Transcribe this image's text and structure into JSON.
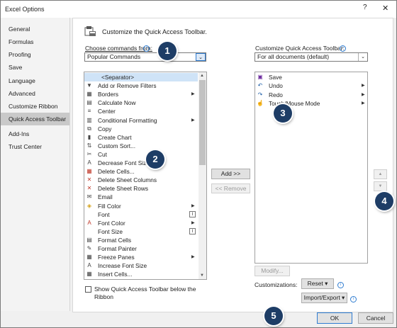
{
  "window": {
    "title": "Excel Options",
    "help_glyph": "?",
    "close_glyph": "✕"
  },
  "nav": {
    "items": [
      {
        "label": "General"
      },
      {
        "label": "Formulas"
      },
      {
        "label": "Proofing"
      },
      {
        "label": "Save"
      },
      {
        "label": "Language"
      },
      {
        "label": "Advanced"
      },
      {
        "label": "Customize Ribbon"
      },
      {
        "label": "Quick Access Toolbar",
        "active": true
      },
      {
        "label": "Add-Ins"
      },
      {
        "label": "Trust Center"
      }
    ]
  },
  "main": {
    "heading": "Customize the Quick Access Toolbar.",
    "choose_label": "Choose commands from:",
    "choose_value": "Popular Commands",
    "customize_label": "Customize Quick Access Toolbar:",
    "customize_value": "For all documents (default)",
    "commands": [
      {
        "label": "<Separator>",
        "icon": "separator-icon"
      },
      {
        "label": "Add or Remove Filters",
        "icon": "filter-icon"
      },
      {
        "label": "Borders",
        "icon": "borders-icon",
        "submenu": true
      },
      {
        "label": "Calculate Now",
        "icon": "calculator-icon"
      },
      {
        "label": "Center",
        "icon": "align-center-icon"
      },
      {
        "label": "Conditional Formatting",
        "icon": "conditional-formatting-icon",
        "submenu": true
      },
      {
        "label": "Copy",
        "icon": "copy-icon"
      },
      {
        "label": "Create Chart",
        "icon": "chart-icon"
      },
      {
        "label": "Custom Sort...",
        "icon": "sort-icon"
      },
      {
        "label": "Cut",
        "icon": "scissors-icon"
      },
      {
        "label": "Decrease Font Size",
        "icon": "decrease-font-icon"
      },
      {
        "label": "Delete Cells...",
        "icon": "delete-cells-icon"
      },
      {
        "label": "Delete Sheet Columns",
        "icon": "delete-columns-icon"
      },
      {
        "label": "Delete Sheet Rows",
        "icon": "delete-rows-icon"
      },
      {
        "label": "Email",
        "icon": "email-icon"
      },
      {
        "label": "Fill Color",
        "icon": "fill-color-icon",
        "submenu": true
      },
      {
        "label": "Font",
        "icon": "",
        "boxed": true
      },
      {
        "label": "Font Color",
        "icon": "font-color-icon",
        "submenu": true
      },
      {
        "label": "Font Size",
        "icon": "",
        "boxed": true
      },
      {
        "label": "Format Cells",
        "icon": "format-cells-icon"
      },
      {
        "label": "Format Painter",
        "icon": "format-painter-icon"
      },
      {
        "label": "Freeze Panes",
        "icon": "freeze-panes-icon",
        "submenu": true
      },
      {
        "label": "Increase Font Size",
        "icon": "increase-font-icon"
      },
      {
        "label": "Insert Cells...",
        "icon": "insert-cells-icon"
      }
    ],
    "toolbar_items": [
      {
        "label": "Save",
        "icon": "save-icon"
      },
      {
        "label": "Undo",
        "icon": "undo-icon",
        "submenu": true
      },
      {
        "label": "Redo",
        "icon": "redo-icon",
        "submenu": true
      },
      {
        "label": "Touch/Mouse Mode",
        "icon": "touch-icon",
        "submenu": true
      }
    ],
    "add_button": "Add >>",
    "remove_button": "<< Remove",
    "modify_button": "Modify...",
    "customizations_label": "Customizations:",
    "reset_button": "Reset ▾",
    "import_export_button": "Import/Export ▾",
    "show_below_line1": "Show Quick Access Toolbar below the",
    "show_below_line2": "Ribbon",
    "up_glyph": "▲",
    "down_glyph": "▼"
  },
  "footer": {
    "ok": "OK",
    "cancel": "Cancel"
  },
  "markers": [
    "1",
    "2",
    "3",
    "4",
    "5"
  ],
  "colors": {
    "marker": "#1e3d66",
    "selection": "#cfe3f7",
    "active_nav": "#c9c9c9"
  }
}
